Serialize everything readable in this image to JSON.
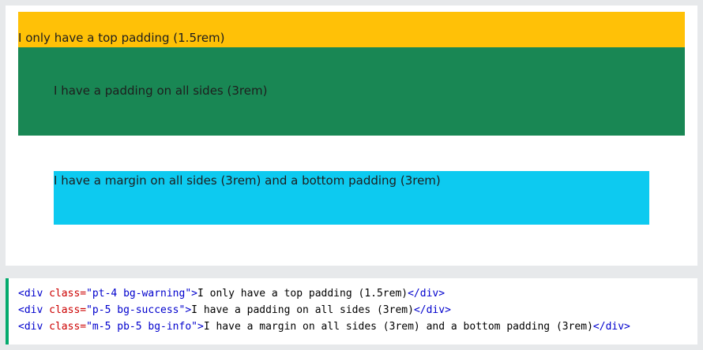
{
  "demo": {
    "boxes": [
      {
        "label": "I only have a top padding (1.5rem)",
        "color": "#ffc107"
      },
      {
        "label": "I have a padding on all sides (3rem)",
        "color": "#198754"
      },
      {
        "label": "I have a margin on all sides (3rem) and a bottom padding (3rem)",
        "color": "#0dcaf0"
      }
    ]
  },
  "code": {
    "lines": [
      {
        "open": "<div ",
        "attr": "class=",
        "value": "\"pt-4 bg-warning\"",
        "gt": ">",
        "text": "I only have a top padding (1.5rem)",
        "close": "</div>"
      },
      {
        "open": "<div ",
        "attr": "class=",
        "value": "\"p-5 bg-success\"",
        "gt": ">",
        "text": "I have a padding on all sides (3rem)",
        "close": "</div>"
      },
      {
        "open": "<div ",
        "attr": "class=",
        "value": "\"m-5 pb-5 bg-info\"",
        "gt": ">",
        "text": "I have a margin on all sides (3rem) and a bottom padding (3rem)",
        "close": "</div>"
      }
    ],
    "accent_color": "#04aa6d"
  }
}
